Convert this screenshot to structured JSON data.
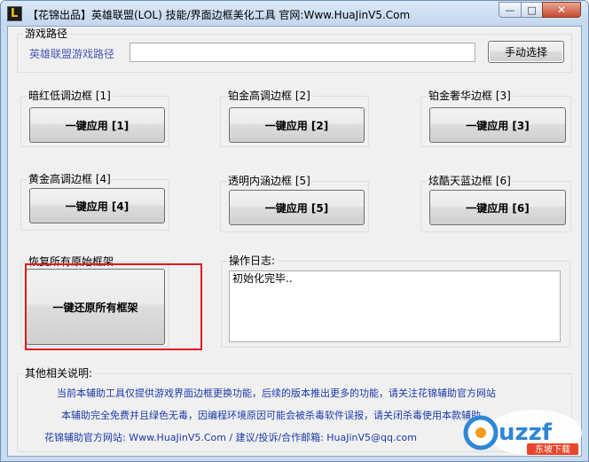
{
  "window": {
    "title": "【花锦出品】英雄联盟(LOL) 技能/界面边框美化工具 官网:Www.HuaJinV5.Com",
    "controls": {
      "minimize": "—",
      "maximize": "□",
      "close": "✕"
    }
  },
  "game_path": {
    "group_label": "游戏路径",
    "field_label": "英雄联盟游戏路径",
    "value": "",
    "manual_button": "手动选择"
  },
  "frames": [
    {
      "group_label": "暗红低调边框 [1]",
      "button": "一键应用 [1]"
    },
    {
      "group_label": "铂金高调边框 [2]",
      "button": "一键应用 [2]"
    },
    {
      "group_label": "铂金奢华边框 [3]",
      "button": "一键应用 [3]"
    },
    {
      "group_label": "黄金高调边框 [4]",
      "button": "一键应用 [4]"
    },
    {
      "group_label": "透明内涵边框 [5]",
      "button": "一键应用 [5]"
    },
    {
      "group_label": "炫酷天蓝边框 [6]",
      "button": "一键应用 [6]"
    }
  ],
  "restore": {
    "group_label": "恢复所有原始框架",
    "button": "一键还原所有框架"
  },
  "log": {
    "group_label": "操作日志:",
    "text": "初始化完毕.."
  },
  "notes": {
    "group_label": "其他相关说明:",
    "lines": [
      "当前本辅助工具仅提供游戏界面边框更换功能，后续的版本推出更多的功能，请关注花锦辅助官方网站",
      "本辅助完全免费并且绿色无毒，因编程环境原因可能会被杀毒软件误报，请关闭杀毒使用本款辅助",
      "花锦辅助官方网站: Www.HuaJinV5.Com / 建议/投诉/合作邮箱: HuaJinV5@qq.com"
    ]
  },
  "watermark": {
    "text": "uzzf",
    "sub": "东坡下载"
  },
  "colors": {
    "red_highlight": "#e0191c",
    "note_text": "#1a3aa8",
    "label_text": "#4a58b6"
  }
}
